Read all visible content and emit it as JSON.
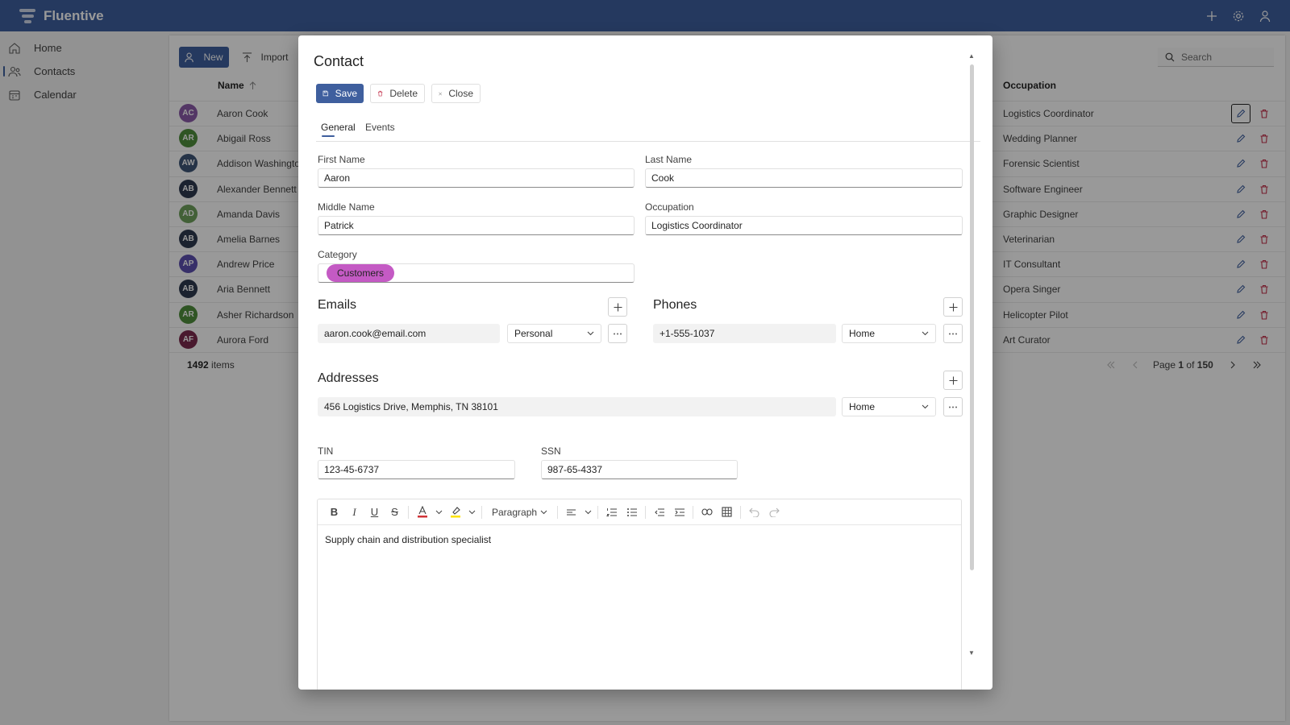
{
  "app": {
    "name": "Fluentive"
  },
  "nav": {
    "items": [
      {
        "label": "Home",
        "icon": "home-icon"
      },
      {
        "label": "Contacts",
        "icon": "contacts-icon",
        "active": true
      },
      {
        "label": "Calendar",
        "icon": "calendar-icon"
      }
    ]
  },
  "toolbar": {
    "new_label": "New",
    "import_label": "Import",
    "search_placeholder": "Search"
  },
  "grid": {
    "col_name": "Name",
    "col_occupation": "Occupation",
    "rows": [
      {
        "initials": "AC",
        "name": "Aaron Cook",
        "occupation": "Logistics Coordinator",
        "color": "#8a5ba8"
      },
      {
        "initials": "AR",
        "name": "Abigail Ross",
        "occupation": "Wedding Planner",
        "color": "#4f8e3c"
      },
      {
        "initials": "AW",
        "name": "Addison Washington",
        "occupation": "Forensic Scientist",
        "color": "#3e5577"
      },
      {
        "initials": "AB",
        "name": "Alexander Bennett",
        "occupation": "Software Engineer",
        "color": "#2d3a4f"
      },
      {
        "initials": "AD",
        "name": "Amanda Davis",
        "occupation": "Graphic Designer",
        "color": "#6ea05c"
      },
      {
        "initials": "AB",
        "name": "Amelia Barnes",
        "occupation": "Veterinarian",
        "color": "#2d3a4f"
      },
      {
        "initials": "AP",
        "name": "Andrew Price",
        "occupation": "IT Consultant",
        "color": "#5d4fb0"
      },
      {
        "initials": "AB",
        "name": "Aria Bennett",
        "occupation": "Opera Singer",
        "color": "#2d3a4f"
      },
      {
        "initials": "AR",
        "name": "Asher Richardson",
        "occupation": "Helicopter Pilot",
        "color": "#4f8e3c"
      },
      {
        "initials": "AF",
        "name": "Aurora Ford",
        "occupation": "Art Curator",
        "color": "#7b2a4d"
      }
    ],
    "items_count": "1492",
    "items_label": "items"
  },
  "pager": {
    "page_label": "Page",
    "current": "1",
    "of_label": "of",
    "total": "150"
  },
  "dialog": {
    "title": "Contact",
    "save_label": "Save",
    "delete_label": "Delete",
    "close_label": "Close",
    "tabs": [
      "General",
      "Events"
    ],
    "first_name_label": "First Name",
    "first_name": "Aaron",
    "last_name_label": "Last Name",
    "last_name": "Cook",
    "middle_name_label": "Middle Name",
    "middle_name": "Patrick",
    "occupation_label": "Occupation",
    "occupation": "Logistics Coordinator",
    "category_label": "Category",
    "category": "Customers",
    "emails_label": "Emails",
    "email": "aaron.cook@email.com",
    "email_type": "Personal",
    "phones_label": "Phones",
    "phone": "+1-555-1037",
    "phone_type": "Home",
    "addresses_label": "Addresses",
    "address": "456 Logistics Drive, Memphis, TN 38101",
    "address_type": "Home",
    "tin_label": "TIN",
    "tin": "123-45-6737",
    "ssn_label": "SSN",
    "ssn": "987-65-4337",
    "editor_paragraph": "Paragraph",
    "notes": "Supply chain and distribution specialist"
  }
}
